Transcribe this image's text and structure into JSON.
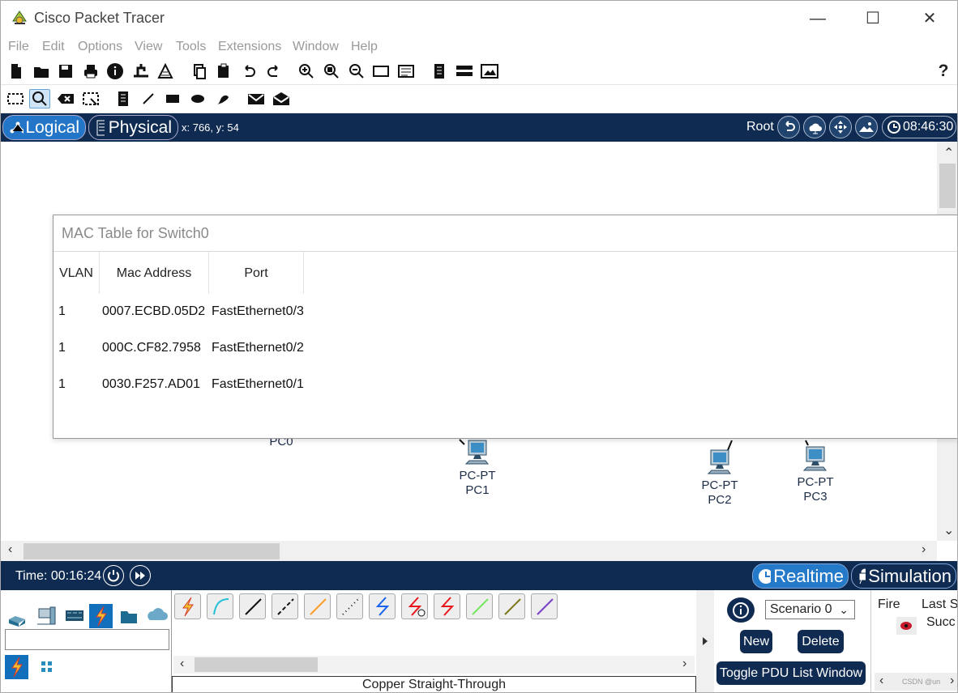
{
  "window": {
    "title": "Cisco Packet Tracer",
    "minimize": "—",
    "maximize": "☐",
    "close": "✕"
  },
  "menu": [
    "File",
    "Edit",
    "Options",
    "View",
    "Tools",
    "Extensions",
    "Window",
    "Help"
  ],
  "toolbar": {
    "main_icons": [
      "new-file-icon",
      "open-folder-icon",
      "save-icon",
      "print-icon",
      "info-icon",
      "activity-wizard-icon",
      "pdu-icon",
      "copy-icon",
      "paste-icon",
      "undo-icon",
      "redo-icon",
      "zoom-in-icon",
      "zoom-reset-icon",
      "zoom-out-icon",
      "drawing-palette-icon",
      "custom-device-icon",
      "note-icon",
      "server-icon",
      "image-icon",
      "help-icon"
    ],
    "edit_icons": [
      "select-icon",
      "inspect-icon",
      "delete-icon",
      "resize-icon",
      "note-tool-icon",
      "line-tool-icon",
      "rectangle-tool-icon",
      "ellipse-tool-icon",
      "freeform-tool-icon",
      "simple-pdu-icon",
      "complex-pdu-icon"
    ]
  },
  "navigation": {
    "logical_label": "Logical",
    "physical_label": "Physical",
    "coordinates": "x: 766, y: 54",
    "root_label": "Root",
    "time": "08:46:30"
  },
  "workspace": {
    "devices": [
      {
        "type": "",
        "name": "PC0"
      },
      {
        "type": "PC-PT",
        "name": "PC1"
      },
      {
        "type": "PC-PT",
        "name": "PC2"
      },
      {
        "type": "PC-PT",
        "name": "PC3"
      }
    ]
  },
  "mac_table": {
    "title": "MAC Table for Switch0",
    "headers": [
      "VLAN",
      "Mac Address",
      "Port"
    ],
    "rows": [
      {
        "vlan": "1",
        "mac": "0007.ECBD.05D2",
        "port": "FastEthernet0/3"
      },
      {
        "vlan": "1",
        "mac": "000C.CF82.7958",
        "port": "FastEthernet0/2"
      },
      {
        "vlan": "1",
        "mac": "0030.F257.AD01",
        "port": "FastEthernet0/1"
      }
    ]
  },
  "simulation": {
    "time_label": "Time: 00:16:24",
    "realtime_label": "Realtime",
    "simulation_label": "Simulation"
  },
  "bottom": {
    "connection_type": "Copper Straight-Through",
    "scenario": "Scenario 0",
    "new_label": "New",
    "delete_label": "Delete",
    "toggle_label": "Toggle PDU List Window",
    "fire_label": "Fire",
    "last_status_label": "Last S",
    "pdu_status": "Succ",
    "watermark": "CSDN @un"
  },
  "colors": {
    "nav_dark": "#102b52",
    "nav_active": "#2376c7",
    "selected_palette": "#126fbc",
    "canvas": "#ffffff"
  }
}
